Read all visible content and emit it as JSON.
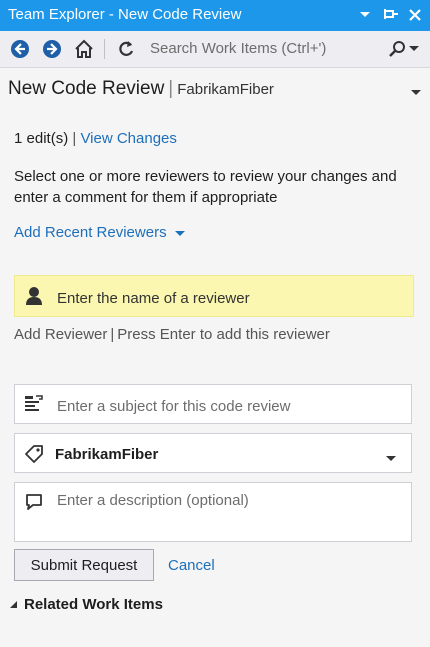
{
  "window": {
    "title": "Team Explorer - New Code Review"
  },
  "toolbar": {
    "back_icon": "back-arrow-icon",
    "forward_icon": "forward-arrow-icon",
    "home_icon": "home-icon",
    "refresh_icon": "refresh-icon",
    "search_placeholder": "Search Work Items (Ctrl+')",
    "search_icon": "search-icon"
  },
  "header": {
    "title": "New Code Review",
    "separator": "|",
    "project": "FabrikamFiber"
  },
  "changes": {
    "count_label": "1 edit(s)",
    "separator": "|",
    "view_link": "View Changes"
  },
  "instructions": "Select one or more reviewers to review your changes and enter a comment for them if appropriate",
  "recent_reviewers": {
    "label": "Add Recent Reviewers"
  },
  "reviewer": {
    "placeholder": "Enter the name of a reviewer",
    "add_label": "Add Reviewer",
    "separator": "|",
    "hint": "Press Enter to add this reviewer"
  },
  "subject": {
    "placeholder": "Enter a subject for this code review"
  },
  "project_select": {
    "value": "FabrikamFiber"
  },
  "description": {
    "placeholder": "Enter a description (optional)"
  },
  "actions": {
    "submit": "Submit Request",
    "cancel": "Cancel"
  },
  "related": {
    "label": "Related Work Items"
  },
  "colors": {
    "title_bar": "#1c97ea",
    "link": "#1e6fbb",
    "reviewer_highlight": "#fbf7b0",
    "background": "#f5f5f5"
  }
}
